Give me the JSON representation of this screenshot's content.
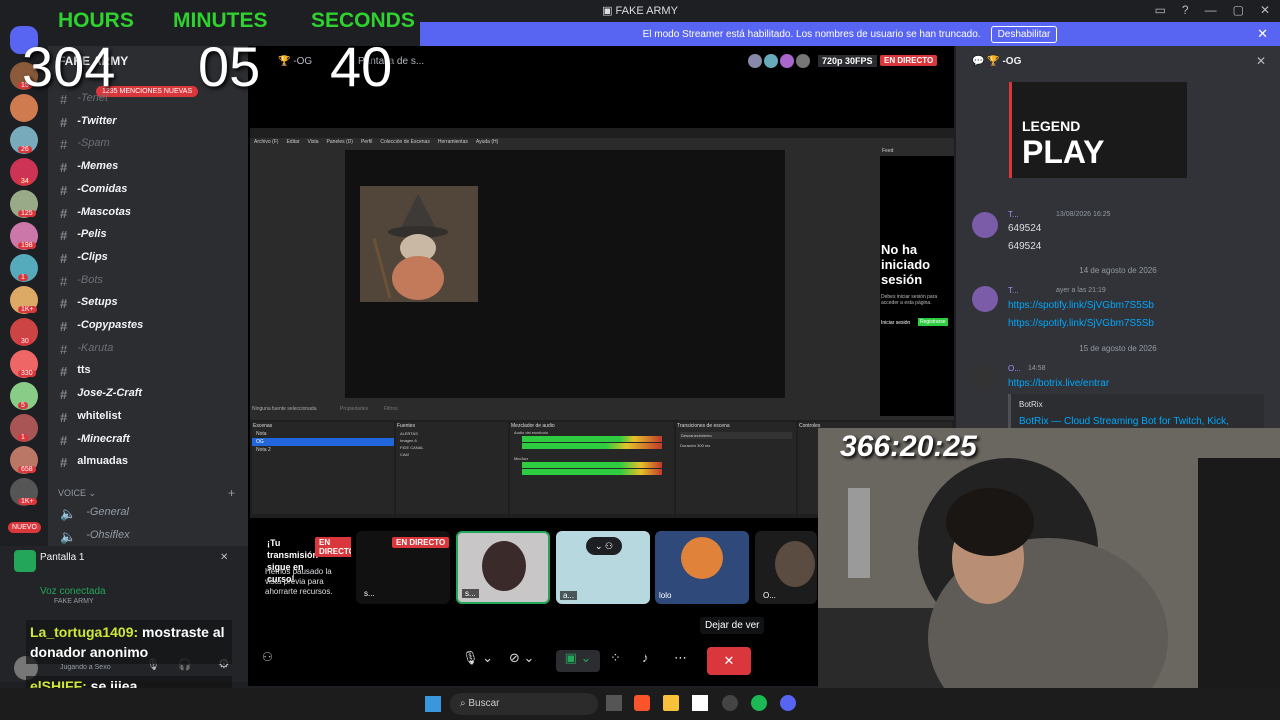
{
  "window": {
    "title": "FAKE ARMY",
    "controls": [
      "▭",
      "?",
      "—",
      "▢",
      "✕"
    ]
  },
  "streamer_banner": {
    "text": "El modo Streamer está habilitado. Los nombres de usuario se han truncado.",
    "button": "Deshabilitar"
  },
  "overlay": {
    "hours_label": "HOURS",
    "minutes_label": "MINUTES",
    "seconds_label": "SECONDS",
    "hours": "304",
    "minutes": "05",
    "seconds": "40",
    "webcam_timer": "366:20:25"
  },
  "server": {
    "name": "FAKE ARMY",
    "mentions_badge": "1235 MENCIONES NUEVAS"
  },
  "server_badges": [
    "15",
    "",
    "26",
    "34",
    "125",
    "198",
    "1",
    "1K+",
    "30",
    "330",
    "5",
    "1",
    "658",
    "1K+"
  ],
  "channels": [
    {
      "name": "-Tenet",
      "dim": true
    },
    {
      "name": "-Twitter",
      "dim": false
    },
    {
      "name": "-Spam",
      "dim": true
    },
    {
      "name": "-Memes",
      "dim": false
    },
    {
      "name": "-Comidas",
      "dim": false
    },
    {
      "name": "-Mascotas",
      "dim": false
    },
    {
      "name": "-Pelis",
      "dim": false
    },
    {
      "name": "-Clips",
      "dim": false
    },
    {
      "name": "-Bots",
      "dim": true
    },
    {
      "name": "-Setups",
      "dim": false
    },
    {
      "name": "-Copypastes",
      "dim": false
    },
    {
      "name": "-Karuta",
      "dim": true
    },
    {
      "name": "tts",
      "dim": false
    },
    {
      "name": "Jose-Z-Craft",
      "dim": false
    },
    {
      "name": "whitelist",
      "dim": false
    },
    {
      "name": "-Minecraft",
      "dim": false
    },
    {
      "name": "almuadas",
      "dim": false
    }
  ],
  "voice_section": {
    "label": "VOICE",
    "channels": [
      "-General",
      "-Ohsiflex"
    ]
  },
  "user_panel": {
    "screen_share": "Pantalla 1",
    "voice_status": "Voz conectada",
    "voice_server": "FAKE ARMY",
    "activity": "Jugando a Sexo",
    "new_badge": "NUEVO"
  },
  "chat_overlay": [
    {
      "user": "La_tortuga1409:",
      "text": "mostraste al donador anonimo"
    },
    {
      "user": "elSHIFF:",
      "text": "se jijea"
    }
  ],
  "stream_header": {
    "channel": "-OG",
    "title": "Pantalla de s...",
    "quality": "720p 30FPS",
    "live": "EN DIRECTO"
  },
  "obs": {
    "menu": [
      "Archivo (F)",
      "Editar",
      "Vista",
      "Paneles (D)",
      "Perfil",
      "Colección de Escenas",
      "Herramientas",
      "Ayuda (H)"
    ],
    "feed_title": "Feed",
    "login_title": "No ha iniciado sesión",
    "login_body": "Debes iniciar sesión para acceder a esta página.",
    "login_link": "Iniciar sesión",
    "register": "Registrarse",
    "no_source": "Ninguna fuente seleccionada",
    "properties": "Propiedades",
    "filters": "Filtros",
    "docks": [
      "Escenas",
      "Fuentes",
      "Mezclador de audio",
      "Transiciones de escena",
      "Controles"
    ],
    "scenes": [
      "Nota",
      "OG",
      "Nota 2"
    ],
    "sources": [
      "ALERTAS",
      "Imagen 6",
      "FIDE CANAL",
      "CAM"
    ],
    "mixer": [
      "Audio del escritorio",
      "Mic/Aux"
    ],
    "transition": "Desvanecimiento",
    "duration_label": "Duración",
    "duration": "300 ms"
  },
  "participants": [
    {
      "name": "s...",
      "live": "EN DIRECTO",
      "paused_title": "¡Tu transmisión sigue en curso!",
      "paused_body": "Hemos pausado la vista previa para ahorrarte recursos."
    },
    {
      "name": "s...",
      "live": "EN DIRECTO"
    },
    {
      "name": "s..."
    },
    {
      "name": "a..."
    },
    {
      "name": "lolo"
    },
    {
      "name": "O..."
    }
  ],
  "controls": {
    "stop_watching_tooltip": "Dejar de ver"
  },
  "chat": {
    "channel": "-OG",
    "embed_word1": "LEGEND",
    "embed_word2": "PLAY",
    "messages": [
      {
        "author": "T...",
        "time": "13/08/2026 16:25",
        "lines": [
          "649524",
          "649524"
        ],
        "links": []
      },
      {
        "divider": "14 de agosto de 2026"
      },
      {
        "author": "T...",
        "time": "ayer a las 21:19",
        "lines": [],
        "links": [
          "https://spotify.link/SjVGbm7S5Sb",
          "https://spotify.link/SjVGbm7S5Sb"
        ]
      },
      {
        "divider": "15 de agosto de 2026"
      },
      {
        "author": "O...",
        "time": "14:58",
        "lines": [],
        "links": [
          "https://botrix.live/entrar"
        ]
      }
    ],
    "embed_provider": "BotRix",
    "embed_title": "BotRix — Cloud Streaming Bot for Twitch, Kick,"
  },
  "taskbar": {
    "search_placeholder": "Buscar"
  },
  "colors": {
    "accent": "#5865f2",
    "live": "#da373c",
    "hud": "#2ed12e",
    "link": "#00a8fc"
  }
}
